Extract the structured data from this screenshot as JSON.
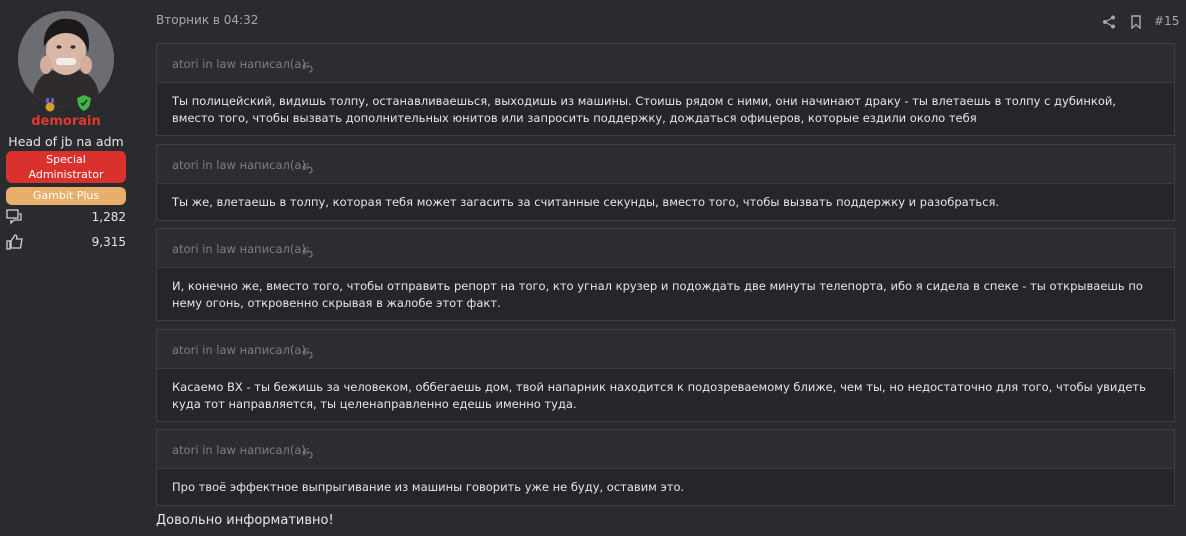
{
  "user": {
    "name": "demorain",
    "title": "Head of jb na adm",
    "badges": [
      {
        "label": "Special Administrator",
        "color": "#d9322e"
      },
      {
        "label": "Gambit Plus",
        "color": "#e8ae6c"
      }
    ],
    "stats": [
      {
        "icon": "messages-icon",
        "value": "1,282"
      },
      {
        "icon": "thumbs-up-icon",
        "value": "9,315"
      }
    ],
    "name_color": "#e0392d"
  },
  "post": {
    "date": "Вторник в 04:32",
    "number": "#15",
    "quotes": [
      {
        "author": "atori in law написал(а):",
        "text": "Ты полицейский, видишь толпу, останавливаешься, выходишь из машины. Стоишь рядом с ними, они начинают драку - ты влетаешь в толпу с дубинкой, вместо того, чтобы вызвать дополнительных юнитов или запросить поддержку, дождаться офицеров, которые ездили около тебя"
      },
      {
        "author": "atori in law написал(а):",
        "text": "Ты же, влетаешь в толпу, которая тебя может загасить за считанные секунды, вместо того, чтобы вызвать поддержку и разобраться."
      },
      {
        "author": "atori in law написал(а):",
        "text": "И, конечно же, вместо того, чтобы отправить репорт на того, кто угнал крузер и подождать две минуты телепорта, ибо я сидела в спеке - ты открываешь по нему огонь, откровенно скрывая в жалобе этот факт."
      },
      {
        "author": "atori in law написал(а):",
        "text": "Касаемо ВХ - ты бежишь за человеком, оббегаешь дом, твой напарник находится к подозреваемому ближе, чем ты, но недостаточно для того, чтобы увидеть куда тот направляется, ты целенаправленно едешь именно туда."
      },
      {
        "author": "atori in law написал(а):",
        "text": "Про твоё эффектное выпрыгивание из машины говорить уже не буду, оставим это."
      }
    ],
    "reply": "Довольно информативно!"
  }
}
